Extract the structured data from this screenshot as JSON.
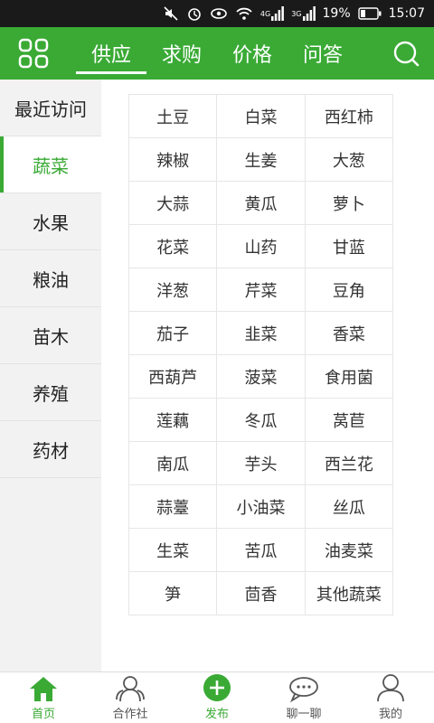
{
  "status_bar": {
    "network_4g": "4G",
    "network_3g": "3G",
    "battery": "19%",
    "time": "15:07"
  },
  "nav": {
    "tabs": [
      {
        "label": "供应",
        "active": true
      },
      {
        "label": "求购",
        "active": false
      },
      {
        "label": "价格",
        "active": false
      },
      {
        "label": "问答",
        "active": false
      }
    ]
  },
  "sidebar": {
    "items": [
      {
        "label": "最近访问",
        "active": false
      },
      {
        "label": "蔬菜",
        "active": true
      },
      {
        "label": "水果",
        "active": false
      },
      {
        "label": "粮油",
        "active": false
      },
      {
        "label": "苗木",
        "active": false
      },
      {
        "label": "养殖",
        "active": false
      },
      {
        "label": "药材",
        "active": false
      }
    ]
  },
  "vegetables": [
    "土豆",
    "白菜",
    "西红柿",
    "辣椒",
    "生姜",
    "大葱",
    "大蒜",
    "黄瓜",
    "萝卜",
    "花菜",
    "山药",
    "甘蓝",
    "洋葱",
    "芹菜",
    "豆角",
    "茄子",
    "韭菜",
    "香菜",
    "西葫芦",
    "菠菜",
    "食用菌",
    "莲藕",
    "冬瓜",
    "莴苣",
    "南瓜",
    "芋头",
    "西兰花",
    "蒜薹",
    "小油菜",
    "丝瓜",
    "生菜",
    "苦瓜",
    "油麦菜",
    "笋",
    "茴香",
    "其他蔬菜"
  ],
  "bottom_bar": {
    "items": [
      {
        "label": "首页",
        "icon": "home-icon",
        "active": true
      },
      {
        "label": "合作社",
        "icon": "cooperative-icon",
        "active": false
      },
      {
        "label": "发布",
        "icon": "publish-plus-icon",
        "active": false
      },
      {
        "label": "聊一聊",
        "icon": "chat-icon",
        "active": false
      },
      {
        "label": "我的",
        "icon": "profile-icon",
        "active": false
      }
    ]
  },
  "colors": {
    "brand_green": "#3aaa35",
    "statusbar_bg": "#1a1a1a",
    "sidebar_bg": "#f2f2f2"
  }
}
